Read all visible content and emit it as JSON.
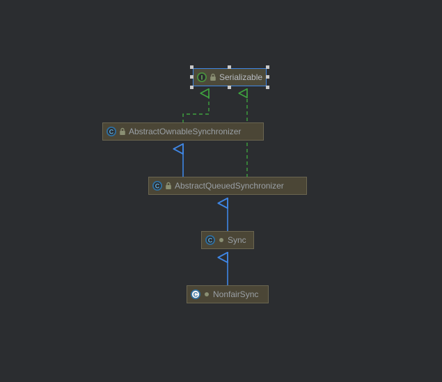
{
  "diagram": {
    "nodes": {
      "serializable": {
        "label": "Serializable",
        "kind": "interface",
        "selected": true
      },
      "aos": {
        "label": "AbstractOwnableSynchronizer",
        "kind": "class",
        "selected": false
      },
      "aqs": {
        "label": "AbstractQueuedSynchronizer",
        "kind": "class",
        "selected": false
      },
      "sync": {
        "label": "Sync",
        "kind": "class",
        "selected": false
      },
      "nonfair": {
        "label": "NonfairSync",
        "kind": "class",
        "selected": false
      }
    },
    "edges": [
      {
        "from": "aos",
        "to": "serializable",
        "type": "implements"
      },
      {
        "from": "aqs",
        "to": "serializable",
        "type": "implements"
      },
      {
        "from": "aqs",
        "to": "aos",
        "type": "extends"
      },
      {
        "from": "sync",
        "to": "aqs",
        "type": "extends"
      },
      {
        "from": "nonfair",
        "to": "sync",
        "type": "extends"
      }
    ]
  },
  "chart_data": {
    "type": "table",
    "title": "Java class hierarchy diagram",
    "nodes": [
      {
        "name": "Serializable",
        "stereotype": "interface"
      },
      {
        "name": "AbstractOwnableSynchronizer",
        "stereotype": "class"
      },
      {
        "name": "AbstractQueuedSynchronizer",
        "stereotype": "class"
      },
      {
        "name": "Sync",
        "stereotype": "class"
      },
      {
        "name": "NonfairSync",
        "stereotype": "class"
      }
    ],
    "edges": [
      {
        "from": "AbstractOwnableSynchronizer",
        "to": "Serializable",
        "relation": "implements"
      },
      {
        "from": "AbstractQueuedSynchronizer",
        "to": "Serializable",
        "relation": "implements"
      },
      {
        "from": "AbstractQueuedSynchronizer",
        "to": "AbstractOwnableSynchronizer",
        "relation": "extends"
      },
      {
        "from": "Sync",
        "to": "AbstractQueuedSynchronizer",
        "relation": "extends"
      },
      {
        "from": "NonfairSync",
        "to": "Sync",
        "relation": "extends"
      }
    ]
  }
}
